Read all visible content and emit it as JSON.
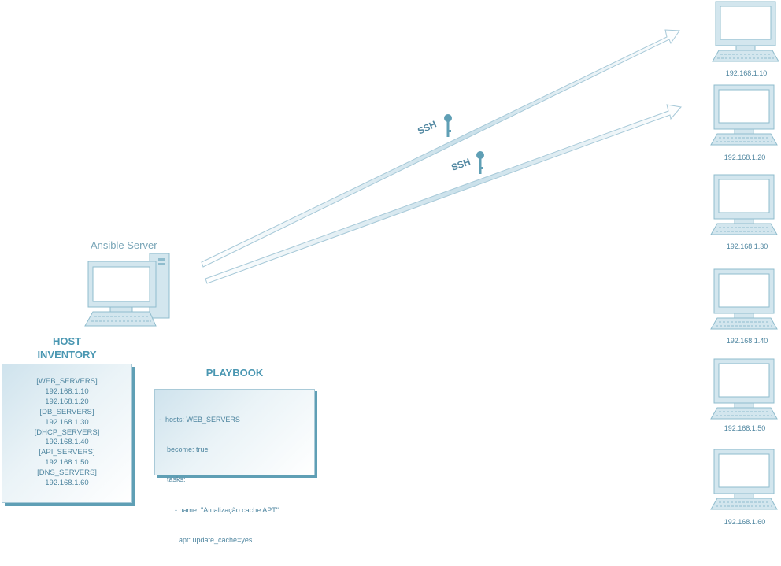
{
  "server": {
    "label": "Ansible Server"
  },
  "inventory": {
    "title_line1": "HOST",
    "title_line2": "INVENTORY",
    "lines": [
      "[WEB_SERVERS]",
      "192.168.1.10",
      "192.168.1.20",
      "[DB_SERVERS]",
      "192.168.1.30",
      "[DHCP_SERVERS]",
      "192.168.1.40",
      "[API_SERVERS]",
      "192.168.1.50",
      "[DNS_SERVERS]",
      "192.168.1.60"
    ]
  },
  "playbook": {
    "title": "PLAYBOOK",
    "lines": [
      "-  hosts: WEB_SERVERS",
      "    become: true",
      "    tasks:",
      "        - name: \"Atualização cache APT\"",
      "          apt: update_cache=yes"
    ]
  },
  "connections": [
    {
      "label": "SSH",
      "icon": "key-icon",
      "target": "192.168.1.10"
    },
    {
      "label": "SSH",
      "icon": "key-icon",
      "target": "192.168.1.20"
    }
  ],
  "hosts": [
    "192.168.1.10",
    "192.168.1.20",
    "192.168.1.30",
    "192.168.1.40",
    "192.168.1.50",
    "192.168.1.60"
  ],
  "colors": {
    "accent": "#4a97b2",
    "text": "#4f86a0",
    "shape_fill": "#d3e6ee",
    "shape_stroke": "#8fbccd"
  }
}
